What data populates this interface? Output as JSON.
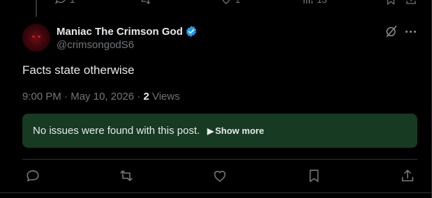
{
  "previous_post": {
    "reply_count": "1",
    "like_count": "1",
    "view_count": "13"
  },
  "post": {
    "author_name": "Maniac The Crimson God",
    "handle": "@crimsongodS6",
    "verified_color": "#1d9bf0",
    "text": "Facts state otherwise",
    "time": "9:00 PM",
    "date": "May 10, 2026",
    "views_count": "2",
    "views_label": "Views"
  },
  "community_note": {
    "background": "#173a22",
    "text": "No issues were found with this post.",
    "show_more_label": "Show more"
  },
  "actions": {
    "icons": [
      "reply-icon",
      "repost-icon",
      "like-icon",
      "bookmark-icon",
      "share-icon"
    ]
  },
  "colors": {
    "background": "#000000",
    "text_primary": "#e7e9ea",
    "text_secondary": "#71767b",
    "border": "#2f3336"
  }
}
